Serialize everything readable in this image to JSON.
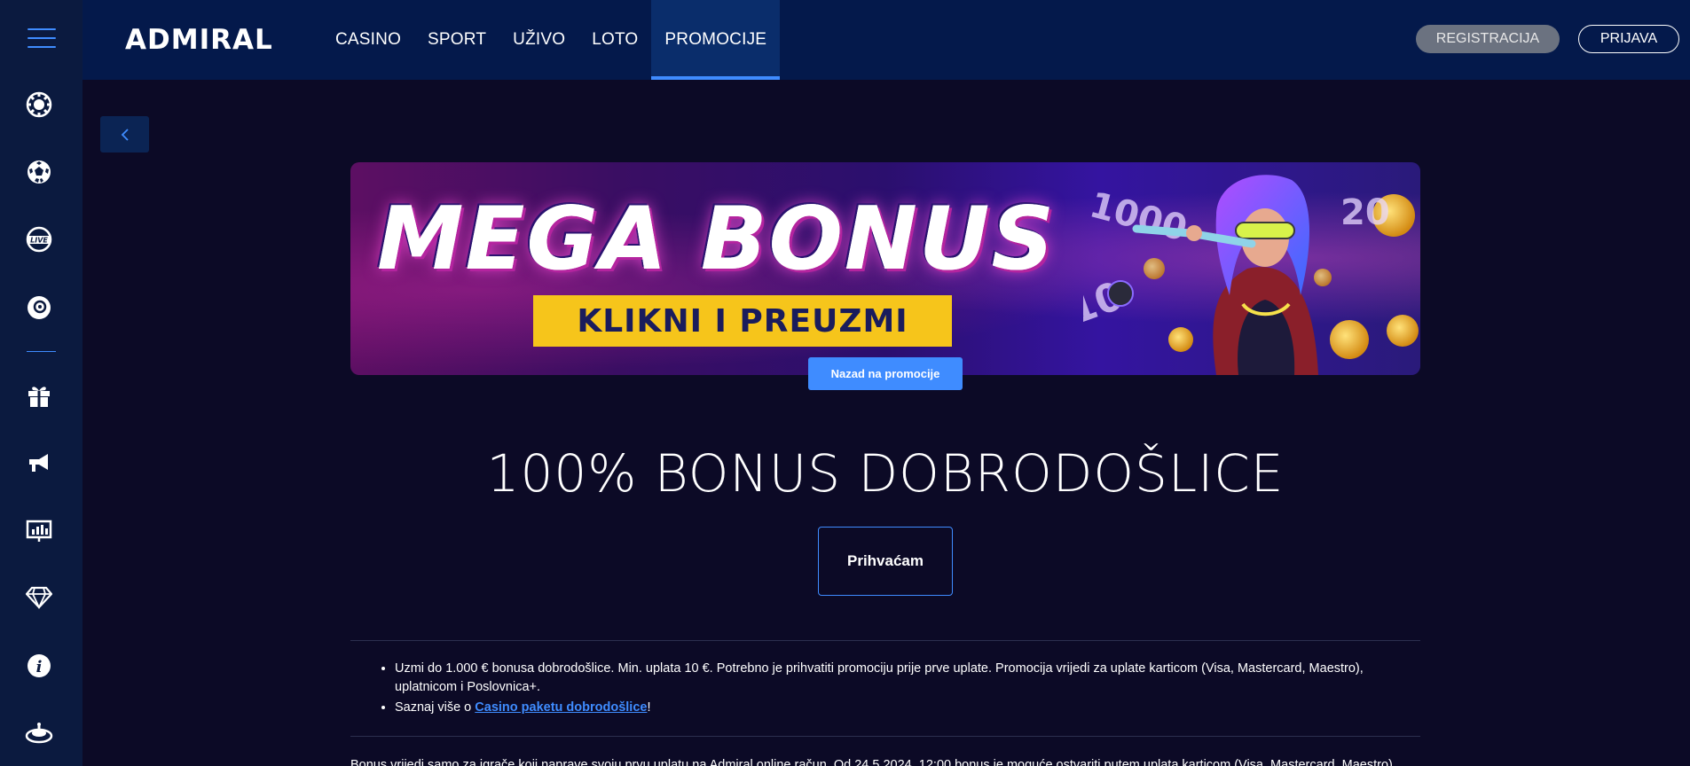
{
  "sidebar": {
    "icons": [
      "casino-chip-icon",
      "soccer-ball-icon",
      "live-icon",
      "lottery-ball-icon",
      "gift-icon",
      "megaphone-icon",
      "results-board-icon",
      "diamond-icon",
      "info-icon",
      "roulette-icon"
    ]
  },
  "header": {
    "logo": "ADMIRAL",
    "nav": [
      {
        "label": "CASINO"
      },
      {
        "label": "SPORT"
      },
      {
        "label": "UŽIVO"
      },
      {
        "label": "LOTO"
      },
      {
        "label": "PROMOCIJE",
        "active": true
      }
    ],
    "register_label": "REGISTRACIJA",
    "login_label": "PRIJAVA"
  },
  "banner": {
    "title": "MEGA BONUS",
    "cta": "KLIKNI I PREUZMI"
  },
  "back_to_promotions": "Nazad na promocije",
  "main": {
    "title": "100% BONUS DOBRODOŠLICE",
    "accept_label": "Prihvaćam",
    "bullets": [
      "Uzmi do 1.000 € bonusa dobrodošlice. Min. uplata 10 €. Potrebno je prihvatiti promociju prije prve uplate. Promocija vrijedi za uplate karticom (Visa, Mastercard, Maestro), uplatnicom i Poslovnica+."
    ],
    "more_prefix": "Saznaj više o ",
    "more_link": "Casino paketu dobrodošlice",
    "more_suffix": "!",
    "footer_text": "Bonus vrijedi samo za igrače koji naprave svoju prvu uplatu na Admiral online račun. Od 24.5.2024. 12:00 bonus je moguće ostvariti putem uplata karticom (Visa, Mastercard, Maestro),"
  },
  "colors": {
    "accent": "#3f8cff",
    "background": "#0c0a26",
    "header": "#04194b",
    "sidebar": "#0b1a3f",
    "cta_yellow": "#f6c51b"
  }
}
